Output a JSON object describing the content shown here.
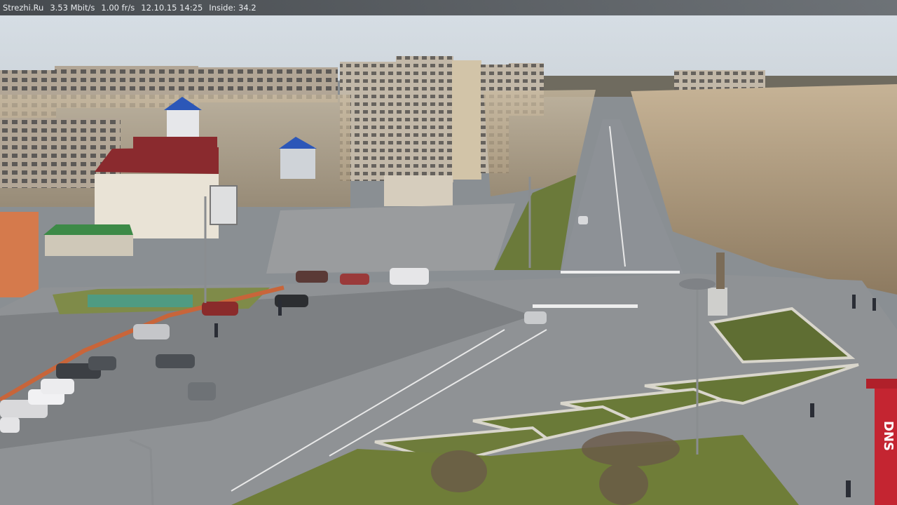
{
  "overlay": {
    "site": "Strezhi.Ru",
    "bitrate": "3.53 Mbit/s",
    "framerate": "1.00 fr/s",
    "datetime": "12.10.15 14:25",
    "inside": "Inside: 34.2"
  },
  "store_sign": {
    "text": "DNS"
  },
  "colors": {
    "sky_top": "#dfe7ee",
    "sky_bottom": "#c9d3db",
    "road": "#8b8f93",
    "grass": "#7a8a44",
    "birch": "#b9a98c",
    "building_red": "#8a2a2e",
    "building_panel": "#b4a898",
    "roof_blue": "#2c57b8",
    "dns_red": "#b0202a"
  }
}
